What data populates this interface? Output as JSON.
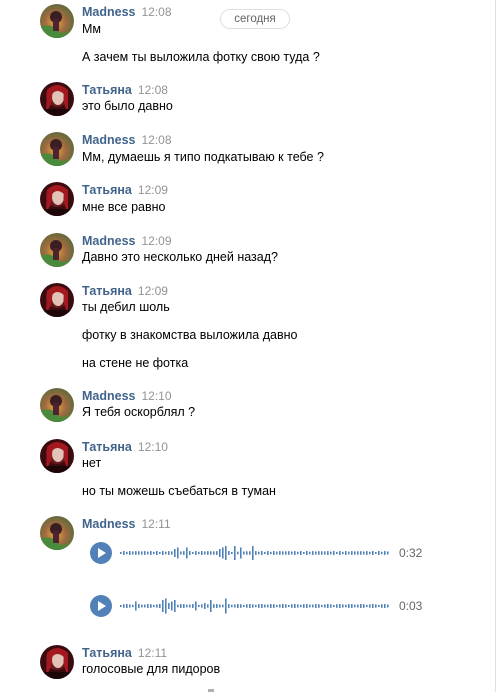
{
  "date_divider": "сегодня",
  "messages": [
    {
      "author": "Madness",
      "time": "12:08",
      "lines": [
        "Мм",
        "А зачем ты выложила фотку свою туда ?"
      ]
    },
    {
      "author": "Татьяна",
      "time": "12:08",
      "lines": [
        "это было давно"
      ]
    },
    {
      "author": "Madness",
      "time": "12:08",
      "lines": [
        "Мм, думаешь я типо подкатываю к тебе ?"
      ]
    },
    {
      "author": "Татьяна",
      "time": "12:09",
      "lines": [
        "мне все равно"
      ]
    },
    {
      "author": "Madness",
      "time": "12:09",
      "lines": [
        "Давно это несколько дней назад?"
      ]
    },
    {
      "author": "Татьяна",
      "time": "12:09",
      "lines": [
        "ты дебил шоль",
        "фотку в знакомства выложила давно",
        "на стене не фотка"
      ]
    },
    {
      "author": "Madness",
      "time": "12:10",
      "lines": [
        "Я тебя оскорблял ?"
      ]
    },
    {
      "author": "Татьяна",
      "time": "12:10",
      "lines": [
        "нет",
        "но ты можешь съебаться в туман"
      ]
    },
    {
      "author": "Madness",
      "time": "12:11",
      "lines": []
    },
    {
      "author": "Татьяна",
      "time": "12:11",
      "lines": [
        "голосовые для пидоров"
      ]
    }
  ],
  "voice_messages": [
    {
      "duration": "0:32"
    },
    {
      "duration": "0:03"
    }
  ],
  "colors": {
    "author": "#42648b",
    "time": "#939393",
    "play_button": "#5181b8",
    "waveform": "#5181b8"
  },
  "icons": {
    "play": "play-icon"
  }
}
